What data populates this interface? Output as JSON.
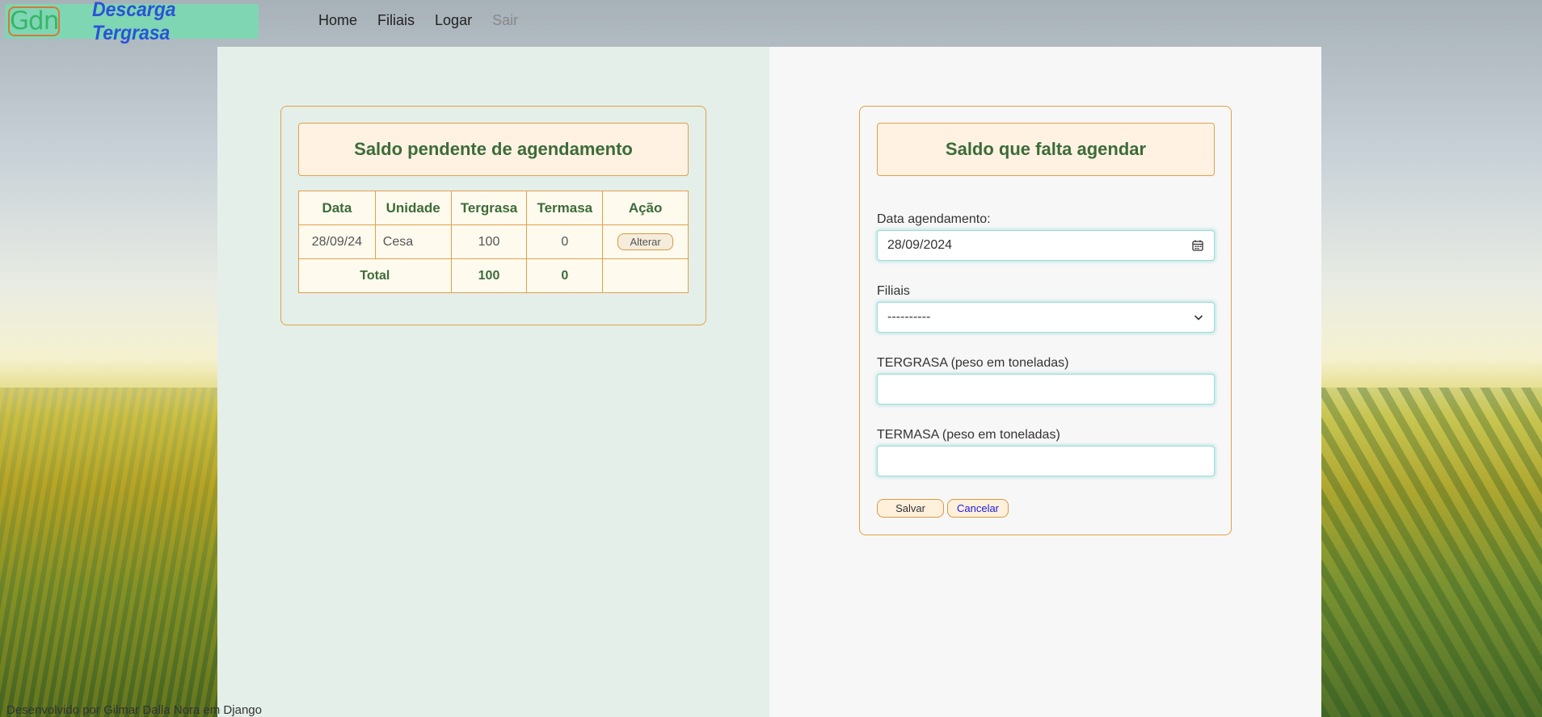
{
  "brand": {
    "logo": "Gdn",
    "title": "Descarga Tergrasa"
  },
  "nav": [
    {
      "label": "Home"
    },
    {
      "label": "Filiais"
    },
    {
      "label": "Logar"
    },
    {
      "label": "Sair"
    }
  ],
  "left_card": {
    "title": "Saldo pendente de agendamento",
    "columns": [
      "Data",
      "Unidade",
      "Tergrasa",
      "Termasa",
      "Ação"
    ],
    "rows": [
      {
        "data": "28/09/24",
        "unidade": "Cesa",
        "tergrasa": "100",
        "termasa": "0",
        "acao": "Alterar"
      }
    ],
    "total": {
      "label": "Total",
      "tergrasa": "100",
      "termasa": "0"
    }
  },
  "right_card": {
    "title": "Saldo que falta agendar",
    "date_label": "Data agendamento:",
    "date_value": "28/09/2024",
    "filiais_label": "Filiais",
    "filiais_value": "----------",
    "tergrasa_label": "TERGRASA (peso em toneladas)",
    "tergrasa_value": "",
    "termasa_label": "TERMASA (peso em toneladas)",
    "termasa_value": "",
    "save_label": "Salvar",
    "cancel_label": "Cancelar"
  },
  "footer": "Desenvolvido por Gilmar Dalla Nora em Django",
  "colors": {
    "accent_border": "#e0a24a",
    "title_text": "#3d6b39",
    "logo_bg": "#7fd6b3",
    "logo_text": "#2c52d6",
    "cancel_text": "#1a1ae0"
  },
  "icons": {
    "date": "calendar-icon",
    "select": "chevron-down-icon"
  }
}
